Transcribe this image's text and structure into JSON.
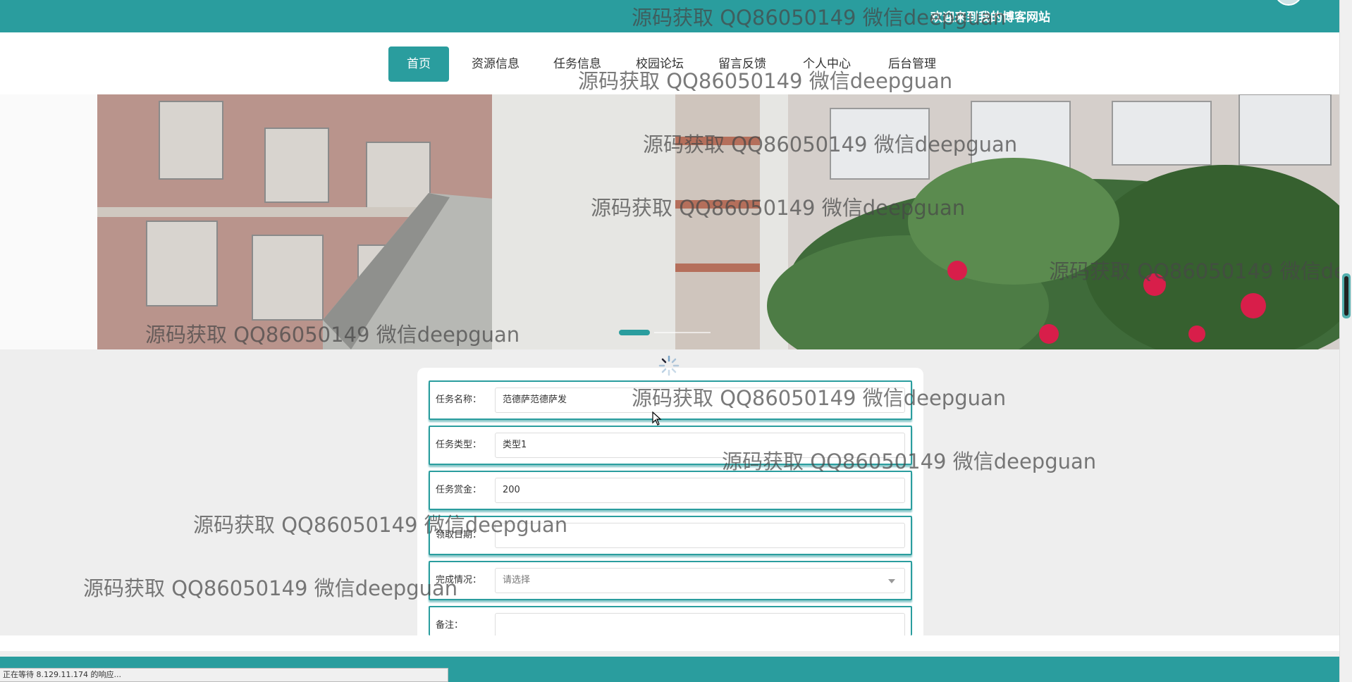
{
  "header": {
    "site_title": "欢迎来到我的博客网站"
  },
  "nav": {
    "items": [
      {
        "label": "首页",
        "active": true
      },
      {
        "label": "资源信息"
      },
      {
        "label": "任务信息"
      },
      {
        "label": "校园论坛"
      },
      {
        "label": "留言反馈"
      },
      {
        "label": "个人中心"
      },
      {
        "label": "后台管理"
      }
    ]
  },
  "form": {
    "fields": [
      {
        "label": "任务名称：",
        "value": "范德萨范德萨发"
      },
      {
        "label": "任务类型：",
        "value": "类型1"
      },
      {
        "label": "任务赏金：",
        "value": "200"
      },
      {
        "label": "领取日期：",
        "value": ""
      },
      {
        "label": "完成情况：",
        "placeholder": "请选择"
      },
      {
        "label": "备注：",
        "value": ""
      }
    ]
  },
  "status_bar": {
    "text": "正在等待 8.129.11.174 的响应..."
  },
  "watermark": {
    "text": "源码获取 QQ86050149 微信deepguan"
  },
  "colors": {
    "accent": "#2a9d9e",
    "background": "#eeeeee"
  }
}
